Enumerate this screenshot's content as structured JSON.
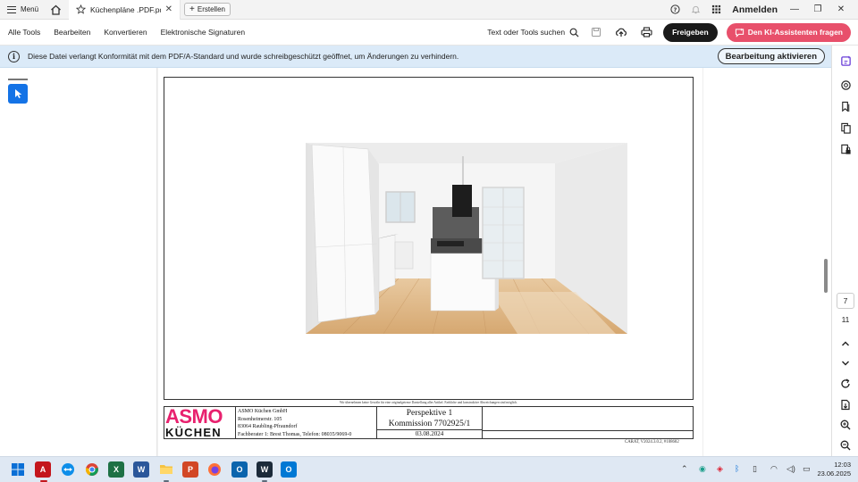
{
  "titlebar": {
    "menu_label": "Menü",
    "tab_title": "Küchenpläne .PDF.pdf",
    "new_tab_label": "Erstellen",
    "signin_label": "Anmelden"
  },
  "toolbar": {
    "items": [
      "Alle Tools",
      "Bearbeiten",
      "Konvertieren",
      "Elektronische Signaturen"
    ],
    "search_label": "Text oder Tools suchen",
    "share_label": "Freigeben",
    "ai_label": "Den KI-Assistenten fragen"
  },
  "infobar": {
    "message": "Diese Datei verlangt Konformität mit dem PDF/A-Standard und wurde schreibgeschützt geöffnet, um Änderungen zu verhindern.",
    "activate_label": "Bearbeitung aktivieren"
  },
  "document": {
    "disclaimer": "Wir übernehmen keine Gewähr für eine originalgetreue Darstellung aller Artikel. Farbliche und konstruktive Abweichungen sind möglich.",
    "logo_line1": "ASMO",
    "logo_line2": "KÜCHEN",
    "company": "ASMO Küchen GmbH",
    "street": "Rosenheimerstr. 105",
    "city": "83064 Raubling-Pfraundorf",
    "advisor": "Fachberater 1: Brest Thomas, Telefon: 08035/9069-0",
    "perspective": "Perspektive 1",
    "commission": "Kommission 7702925/1",
    "date": "03.08.2024",
    "carat": "CARAT, V2024.3.0.2, #108682"
  },
  "pagenav": {
    "current_page": "7",
    "total_pages": "11"
  },
  "taskbar": {
    "time": "12:03",
    "date": "23.06.2025"
  },
  "colors": {
    "accent_blue": "#1473e6",
    "ai_pink": "#e8506b",
    "info_bg": "#dbeaf8",
    "asmo_pink": "#e8216e"
  }
}
